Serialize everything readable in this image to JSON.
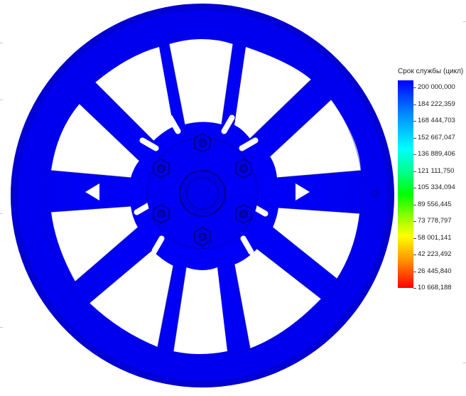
{
  "legend": {
    "title": "Срок службы (цикл)",
    "labels": [
      "200 000,000",
      "184 222,359",
      "168 444,703",
      "152 667,047",
      "136 889,406",
      "121 111,750",
      "105 334,094",
      "89 556,445",
      "73 778,797",
      "58 001,141",
      "42 223,492",
      "26 445,840",
      "10 668,188"
    ]
  },
  "colors": {
    "model": "#0000ff",
    "model_shadow": "#0000b4",
    "model_dark": "#000060",
    "background": "#ffffff"
  }
}
